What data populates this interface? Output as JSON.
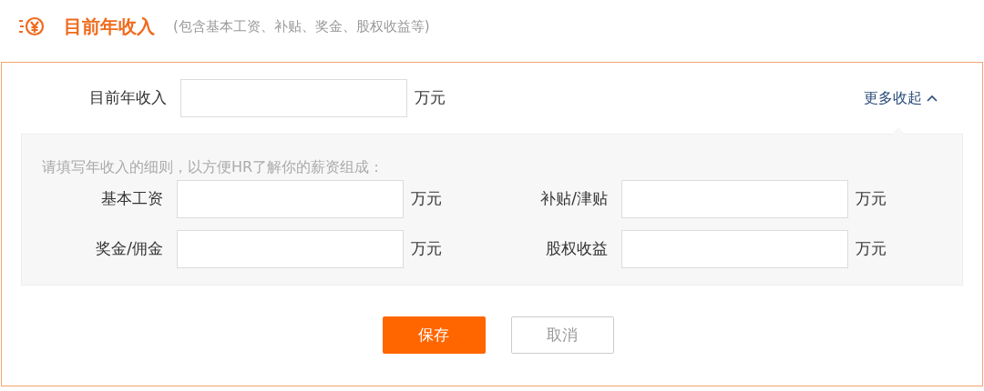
{
  "header": {
    "title": "目前年收入",
    "subtitle": "(包含基本工资、补贴、奖金、股权收益等)"
  },
  "main_field": {
    "label": "目前年收入",
    "unit": "万元"
  },
  "toggle": {
    "label": "更多收起",
    "expanded": true
  },
  "details": {
    "hint": "请填写年收入的细则，以方便HR了解你的薪资组成：",
    "fields": [
      {
        "label": "基本工资",
        "unit": "万元"
      },
      {
        "label": "补贴/津贴",
        "unit": "万元"
      },
      {
        "label": "奖金/佣金",
        "unit": "万元"
      },
      {
        "label": "股权收益",
        "unit": "万元"
      }
    ]
  },
  "buttons": [
    {
      "label": "保存",
      "kind": "primary"
    },
    {
      "label": "取消",
      "kind": "secondary"
    }
  ]
}
